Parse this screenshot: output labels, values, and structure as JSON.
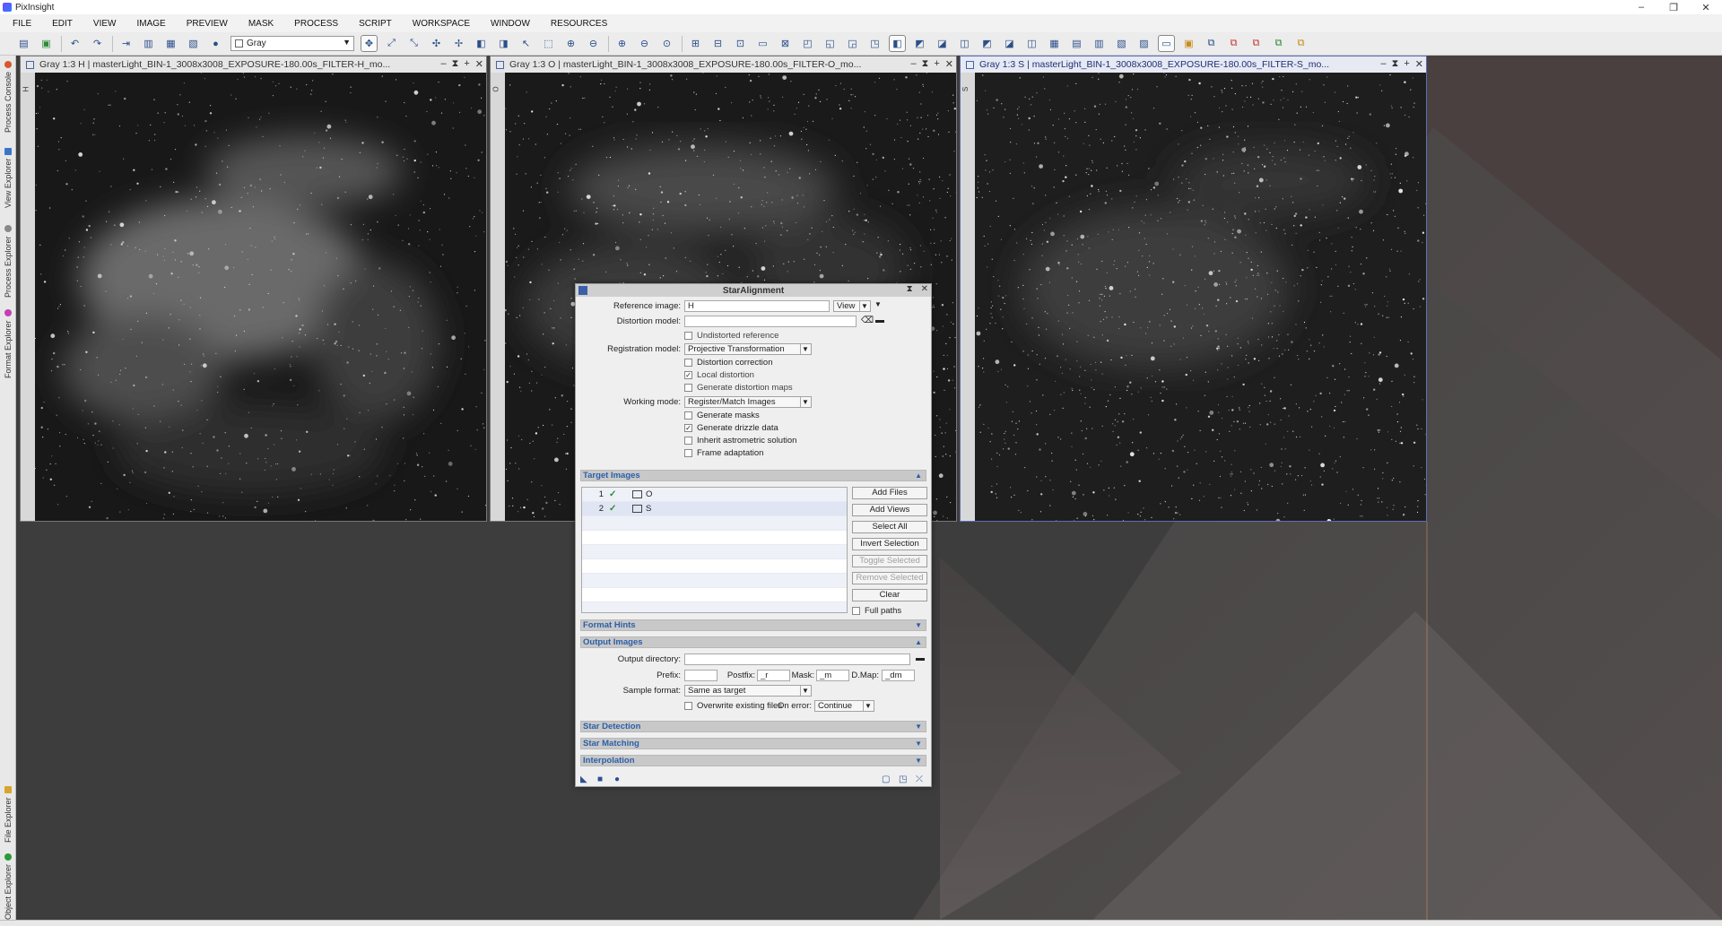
{
  "app": {
    "title": "PixInsight",
    "minimize": "–",
    "maximize": "❐",
    "close": "✕"
  },
  "menu": [
    "FILE",
    "EDIT",
    "VIEW",
    "IMAGE",
    "PREVIEW",
    "MASK",
    "PROCESS",
    "SCRIPT",
    "WORKSPACE",
    "WINDOW",
    "RESOURCES"
  ],
  "toolbar": {
    "colorspace": "Gray"
  },
  "sidebar": {
    "top": [
      "Process Console",
      "View Explorer",
      "Process Explorer",
      "Format Explorer"
    ],
    "bottom": [
      "File Explorer",
      "Object Explorer"
    ]
  },
  "windows": [
    {
      "title": "Gray 1:3 H | masterLight_BIN-1_3008x3008_EXPOSURE-180.00s_FILTER-H_mo...",
      "id": "H"
    },
    {
      "title": "Gray 1:3 O | masterLight_BIN-1_3008x3008_EXPOSURE-180.00s_FILTER-O_mo...",
      "id": "O"
    },
    {
      "title": "Gray 1:3 S | masterLight_BIN-1_3008x3008_EXPOSURE-180.00s_FILTER-S_mo...",
      "id": "S"
    }
  ],
  "window_buttons": {
    "minimize": "–",
    "shade": "⧗",
    "maximize": "+",
    "close": "✕"
  },
  "dialog": {
    "title": "StarAlignment",
    "reference_label": "Reference image:",
    "reference_value": "H",
    "reference_mode": "View",
    "distortion_label": "Distortion model:",
    "distortion_value": "",
    "undistorted_label": "Undistorted reference",
    "registration_label": "Registration model:",
    "registration_value": "Projective Transformation",
    "distortion_correction_label": "Distortion correction",
    "local_distortion_label": "Local distortion",
    "gen_distortion_maps_label": "Generate distortion maps",
    "working_mode_label": "Working mode:",
    "working_mode_value": "Register/Match Images",
    "gen_masks_label": "Generate masks",
    "gen_drizzle_label": "Generate drizzle data",
    "inherit_astrometric_label": "Inherit astrometric solution",
    "frame_adaptation_label": "Frame adaptation",
    "check_mark": "✓",
    "checks": {
      "undistorted": false,
      "distortion_correction": false,
      "local_distortion": true,
      "gen_distortion_maps": false,
      "gen_masks": false,
      "gen_drizzle": true,
      "inherit_astrometric": false,
      "frame_adaptation": false,
      "full_paths": false,
      "overwrite": false
    },
    "target_images_header": "Target Images",
    "targets": [
      {
        "num": "1",
        "name": "O"
      },
      {
        "num": "2",
        "name": "S"
      }
    ],
    "buttons": {
      "add_files": "Add Files",
      "add_views": "Add Views",
      "select_all": "Select All",
      "invert_selection": "Invert Selection",
      "toggle_selected": "Toggle Selected",
      "remove_selected": "Remove Selected",
      "clear": "Clear"
    },
    "full_paths_label": "Full paths",
    "format_hints_header": "Format Hints",
    "output_images_header": "Output Images",
    "output_dir_label": "Output directory:",
    "output_dir_value": "",
    "prefix_label": "Prefix:",
    "prefix_value": "",
    "postfix_label": "Postfix:",
    "postfix_value": "_r",
    "mask_label": "Mask:",
    "mask_value": "_m",
    "dmap_label": "D.Map:",
    "dmap_value": "_dm",
    "sample_format_label": "Sample format:",
    "sample_format_value": "Same as target",
    "overwrite_label": "Overwrite existing files",
    "on_error_label": "On error:",
    "on_error_value": "Continue",
    "star_detection_header": "Star Detection",
    "star_matching_header": "Star Matching",
    "interpolation_header": "Interpolation"
  },
  "colors": {
    "accent": "#2b5fa8",
    "check_ok": "#2c8a2c",
    "workspace": "#3d3d3d"
  }
}
